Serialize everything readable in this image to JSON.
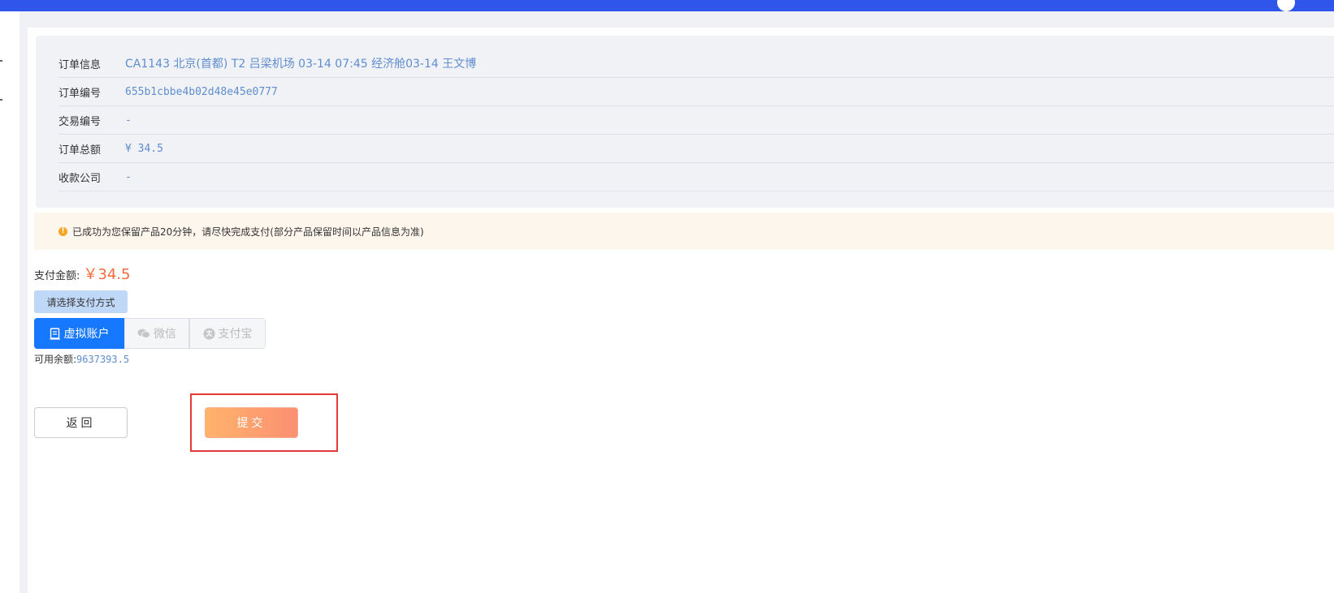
{
  "order_info": {
    "rows": [
      {
        "label": "订单信息",
        "value": "CA1143 北京(首都) T2 吕梁机场 03-14 07:45 经济舱03-14 王文博"
      },
      {
        "label": "订单编号",
        "value": "655b1cbbe4b02d48e45e0777"
      },
      {
        "label": "交易编号",
        "value": "-"
      },
      {
        "label": "订单总额",
        "value": "¥ 34.5"
      },
      {
        "label": "收款公司",
        "value": "-"
      }
    ]
  },
  "notice": {
    "icon": "warning-icon",
    "text": "已成功为您保留产品20分钟，请尽快完成支付(部分产品保留时间以产品信息为准)"
  },
  "payment": {
    "amount_label": "支付金额:",
    "amount_value": "￥34.5",
    "method_tag": "请选择支付方式",
    "methods": [
      {
        "label": "虚拟账户",
        "icon": "wallet-icon",
        "active": true
      },
      {
        "label": "微信",
        "icon": "wechat-icon",
        "active": false
      },
      {
        "label": "支付宝",
        "icon": "alipay-icon",
        "active": false
      }
    ],
    "balance_label": "可用余额:",
    "balance_value": "9637393.5"
  },
  "actions": {
    "back_label": "返回",
    "submit_label": "提交"
  },
  "colors": {
    "topbar": "#2f55eb",
    "accent": "#1677ff",
    "price": "#f36a3c",
    "highlight": "#e53935"
  }
}
